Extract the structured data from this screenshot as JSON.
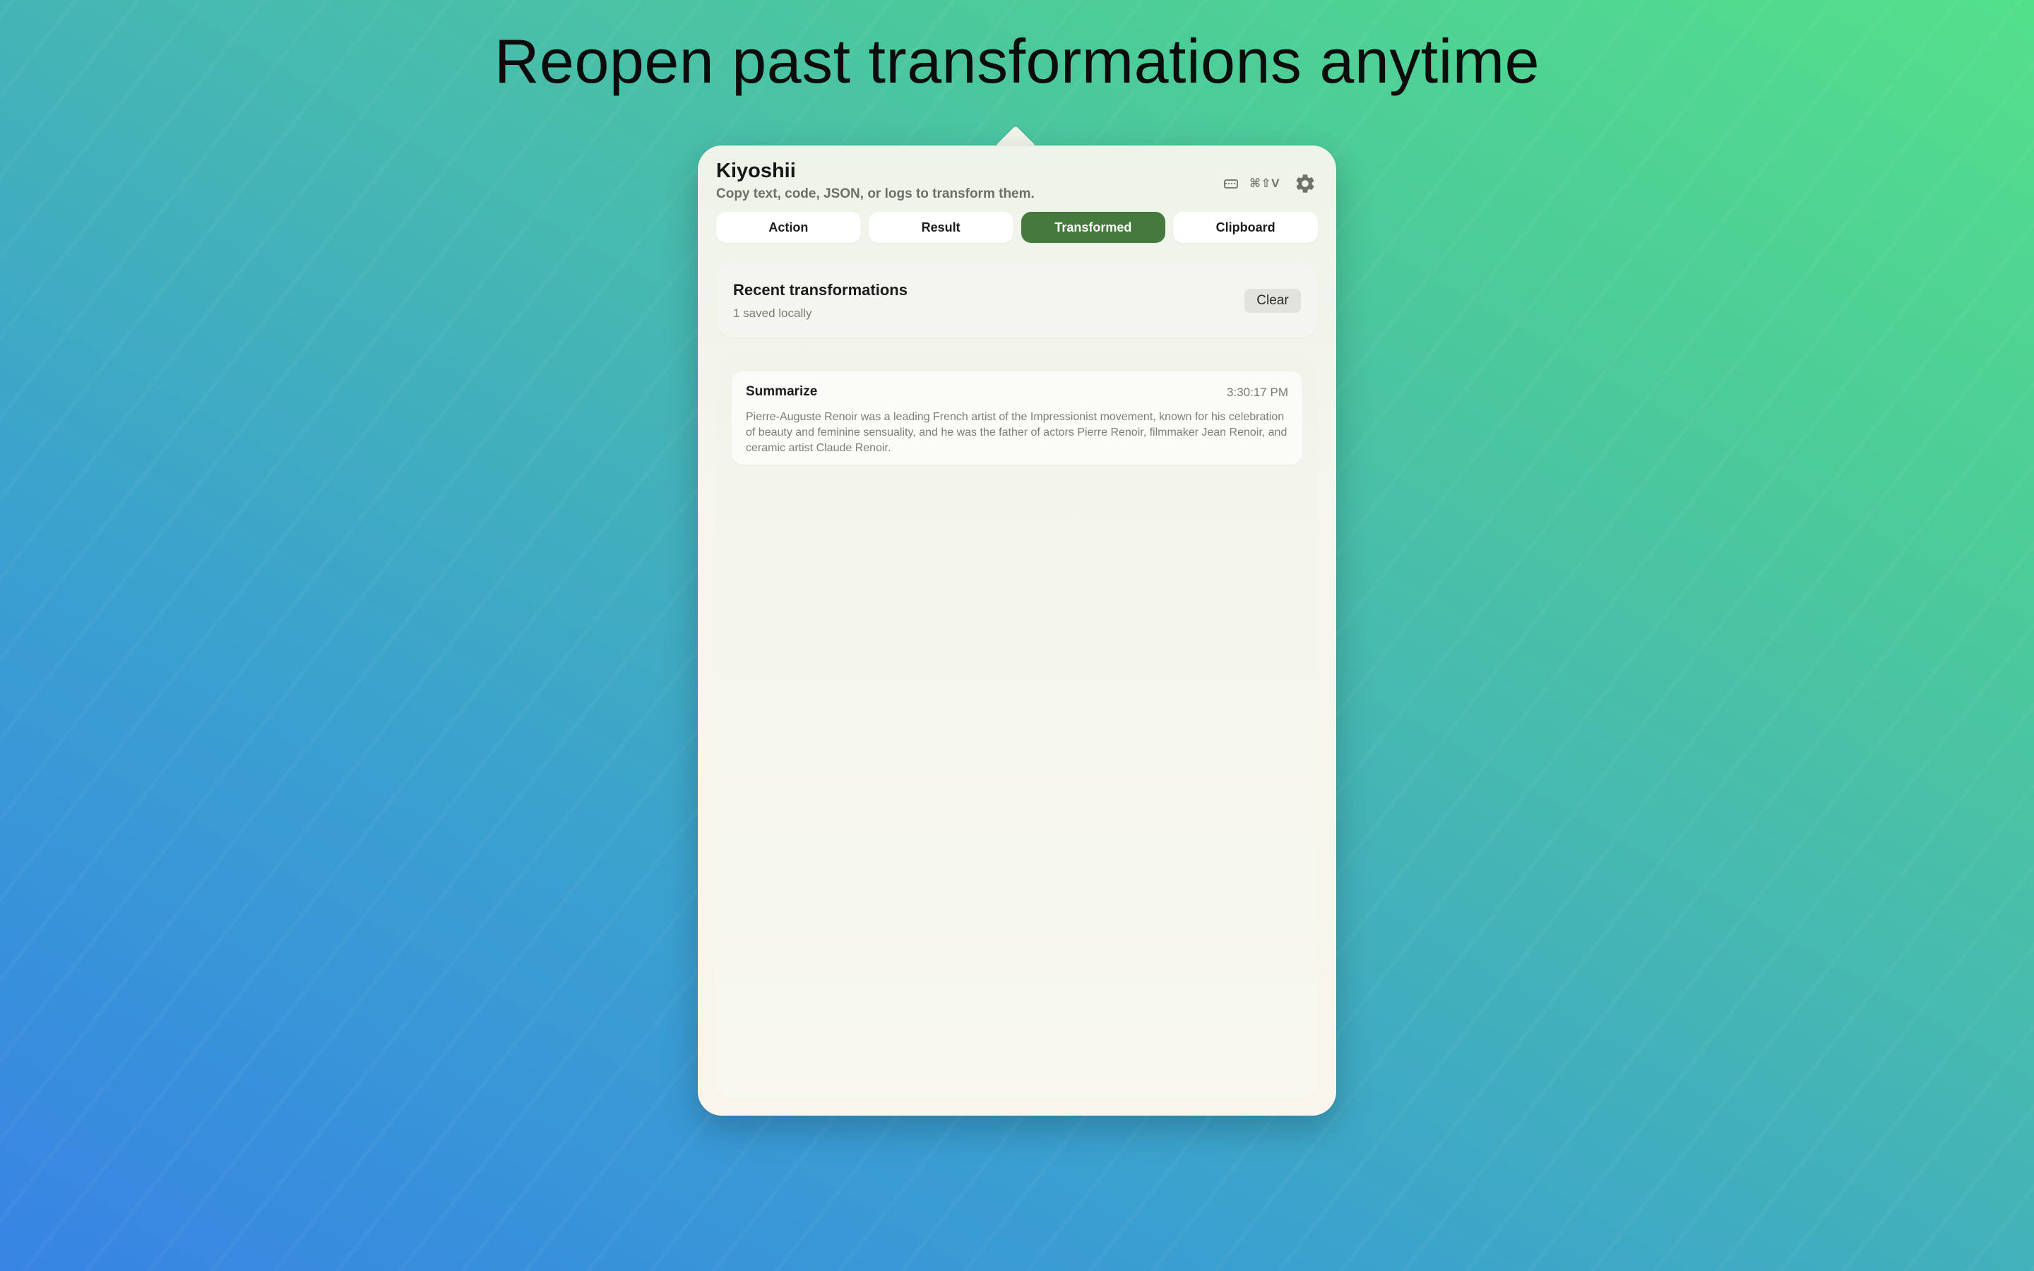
{
  "headline": "Reopen past transformations anytime",
  "app": {
    "title": "Kiyoshii",
    "subtitle": "Copy text, code, JSON, or logs to transform them.",
    "shortcut": "⌘⇧V"
  },
  "tabs": [
    {
      "label": "Action",
      "active": false
    },
    {
      "label": "Result",
      "active": false
    },
    {
      "label": "Transformed",
      "active": true
    },
    {
      "label": "Clipboard",
      "active": false
    }
  ],
  "recent": {
    "title": "Recent transformations",
    "count_text": "1 saved locally",
    "clear_label": "Clear"
  },
  "history": [
    {
      "title": "Summarize",
      "time": "3:30:17 PM",
      "text": "Pierre-Auguste Renoir was a leading French artist of the Impressionist movement, known for his celebration of beauty and feminine sensuality, and he was the father of actors Pierre Renoir, filmmaker Jean Renoir, and ceramic artist Claude Renoir."
    }
  ],
  "colors": {
    "accent": "#45793e",
    "background_start": "#3784e4",
    "background_end": "#53e08a"
  },
  "icons": {
    "keyboard": "keyboard-icon",
    "settings": "gear-icon"
  }
}
